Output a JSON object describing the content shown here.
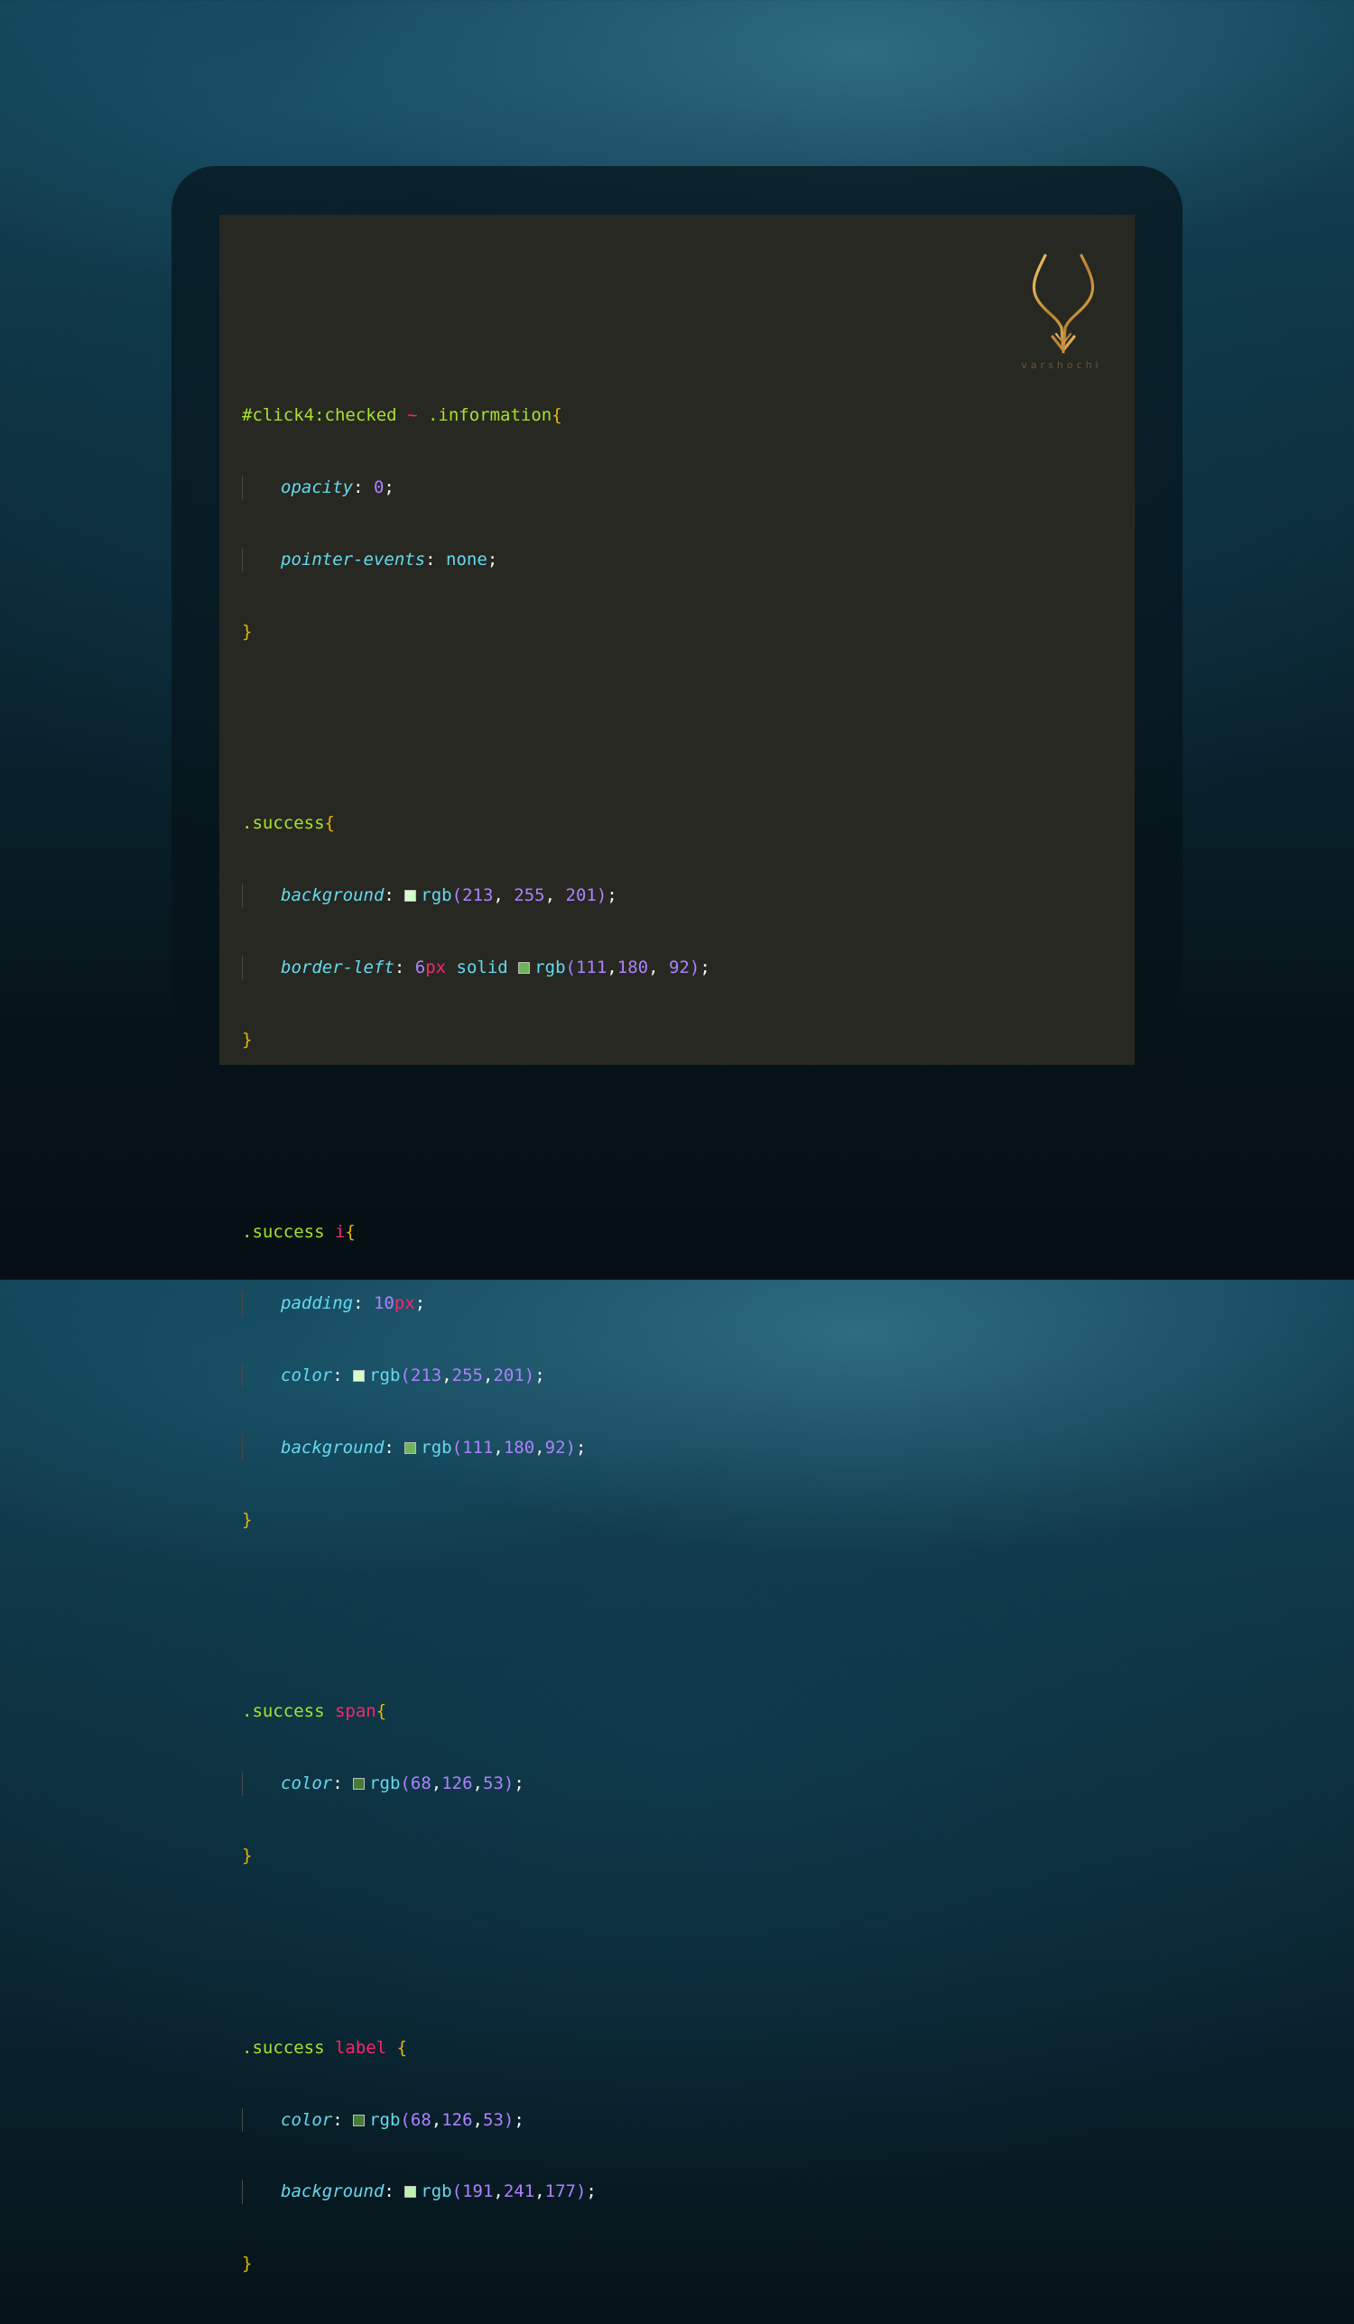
{
  "brand": {
    "name": "varshochi",
    "logo_icon": "antelope-horns-logo-icon",
    "logo_color": "#c9953f"
  },
  "editor": {
    "background": "#272822",
    "theme_colors": {
      "selector": "#a6e22e",
      "tag": "#f92672",
      "property": "#66d9ef",
      "number": "#ae81ff",
      "brace": "#e6b800"
    }
  },
  "code": {
    "rule1": {
      "selector": "#click4:checked",
      "combinator": "~",
      "selector2": ".information",
      "open": "{",
      "close": "}",
      "decls": [
        {
          "prop": "opacity",
          "value": "0"
        },
        {
          "prop": "pointer-events",
          "value": "none"
        }
      ]
    },
    "rule2": {
      "selector": ".success",
      "open": "{",
      "close": "}",
      "decl1": {
        "prop": "background",
        "fn": "rgb",
        "r": "213",
        "g": "255",
        "b": "201",
        "swatch": "#d5ffc9"
      },
      "decl2": {
        "prop": "border-left",
        "size": "6",
        "unit": "px",
        "style": "solid",
        "fn": "rgb",
        "r": "111",
        "g": "180",
        "b": "92",
        "swatch": "#6fb45c"
      }
    },
    "rule3": {
      "selector": ".success",
      "tag": "i",
      "open": "{",
      "close": "}",
      "decl1": {
        "prop": "padding",
        "num": "10",
        "unit": "px"
      },
      "decl2": {
        "prop": "color",
        "fn": "rgb",
        "r": "213",
        "g": "255",
        "b": "201",
        "swatch": "#d5ffc9"
      },
      "decl3": {
        "prop": "background",
        "fn": "rgb",
        "r": "111",
        "g": "180",
        "b": "92",
        "swatch": "#6fb45c"
      }
    },
    "rule4": {
      "selector": ".success",
      "tag": "span",
      "open": "{",
      "close": "}",
      "decl1": {
        "prop": "color",
        "fn": "rgb",
        "r": "68",
        "g": "126",
        "b": "53",
        "swatch": "#447e35"
      }
    },
    "rule5": {
      "selector": ".success",
      "tag": "label",
      "open": "{",
      "close": "}",
      "decl1": {
        "prop": "color",
        "fn": "rgb",
        "r": "68",
        "g": "126",
        "b": "53",
        "swatch": "#447e35"
      },
      "decl2": {
        "prop": "background",
        "fn": "rgb",
        "r": "191",
        "g": "241",
        "b": "177",
        "swatch": "#bff1b1"
      }
    }
  }
}
